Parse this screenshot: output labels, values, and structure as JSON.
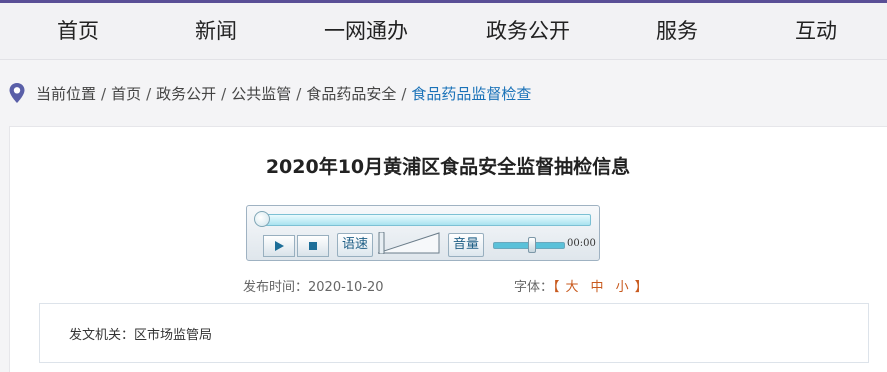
{
  "nav": {
    "items": [
      "首页",
      "新闻",
      "一网通办",
      "政务公开",
      "服务",
      "互动"
    ]
  },
  "breadcrumb": {
    "separator": "/",
    "items": [
      "当前位置",
      "首页",
      "政务公开",
      "公共监管",
      "食品药品安全"
    ],
    "current": "食品药品监督检查"
  },
  "article": {
    "title": "2020年10月黄浦区食品安全监督抽检信息",
    "publish_label": "发布时间：",
    "publish_date": "2020-10-20",
    "font_size_label": "字体：",
    "font_size_options": [
      "大",
      "中",
      "小"
    ],
    "issuer_label": "发文机关：",
    "issuer": "区市场监管局"
  },
  "player": {
    "speed_label": "语速",
    "volume_label": "音量",
    "time": "00:00",
    "progress": 0,
    "volume": 0.55
  },
  "colors": {
    "accent": "#5a4f96",
    "link": "#1a72b8",
    "font_option": "#c85a1e"
  }
}
